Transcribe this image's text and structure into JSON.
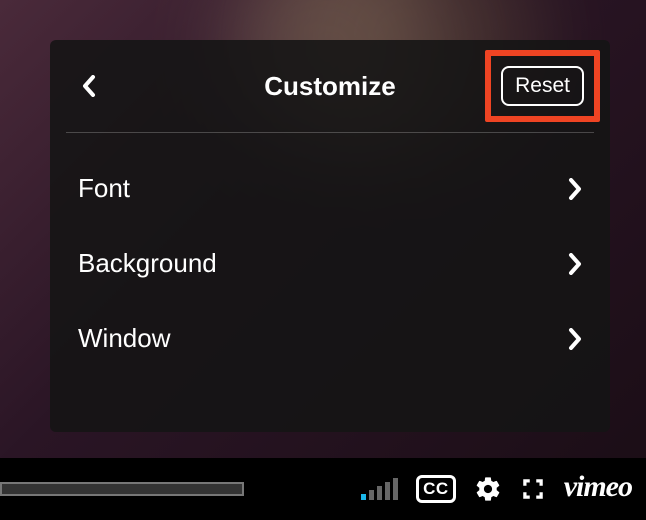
{
  "panel": {
    "title": "Customize",
    "reset_label": "Reset",
    "options": [
      {
        "label": "Font"
      },
      {
        "label": "Background"
      },
      {
        "label": "Window"
      }
    ]
  },
  "controls": {
    "cc_label": "CC",
    "vimeo_label": "vimeo"
  }
}
